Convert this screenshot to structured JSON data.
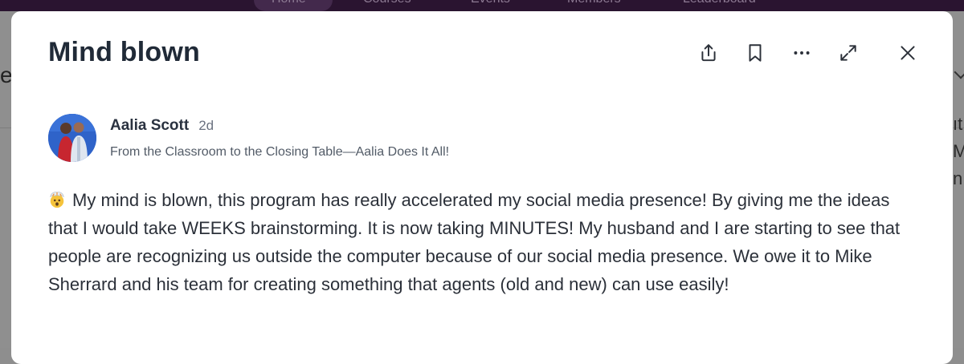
{
  "background": {
    "nav_items": [
      "Home",
      "Courses",
      "Events",
      "Members",
      "Leaderboard"
    ],
    "left_fragment": "e",
    "right_fragments": [
      "ıt",
      "M",
      "n"
    ]
  },
  "modal": {
    "title": "Mind blown",
    "toolbar": {
      "share_icon": "share-icon",
      "bookmark_icon": "bookmark-icon",
      "more_icon": "more-options-icon",
      "expand_icon": "expand-icon",
      "close_icon": "close-icon"
    },
    "author": {
      "name": "Aalia Scott",
      "time": "2d",
      "subtitle": "From the Classroom to the Closing Table—Aalia Does It All!"
    },
    "post": {
      "emoji": "exploding-head-emoji",
      "text": "My mind is blown, this program has really accelerated my social media presence! By giving me the ideas that I would take WEEKS brainstorming. It is now taking MINUTES! My husband and I are starting to see that people are recognizing us outside the computer because of our social media presence. We owe it to Mike Sherrard and his team for creating something that agents (old and new) can use easily!"
    }
  },
  "colors": {
    "title": "#202a37",
    "body": "#2b3039",
    "muted": "#6b7280",
    "backdrop": "#8e8e8e",
    "nav_bar": "#2a1430"
  }
}
